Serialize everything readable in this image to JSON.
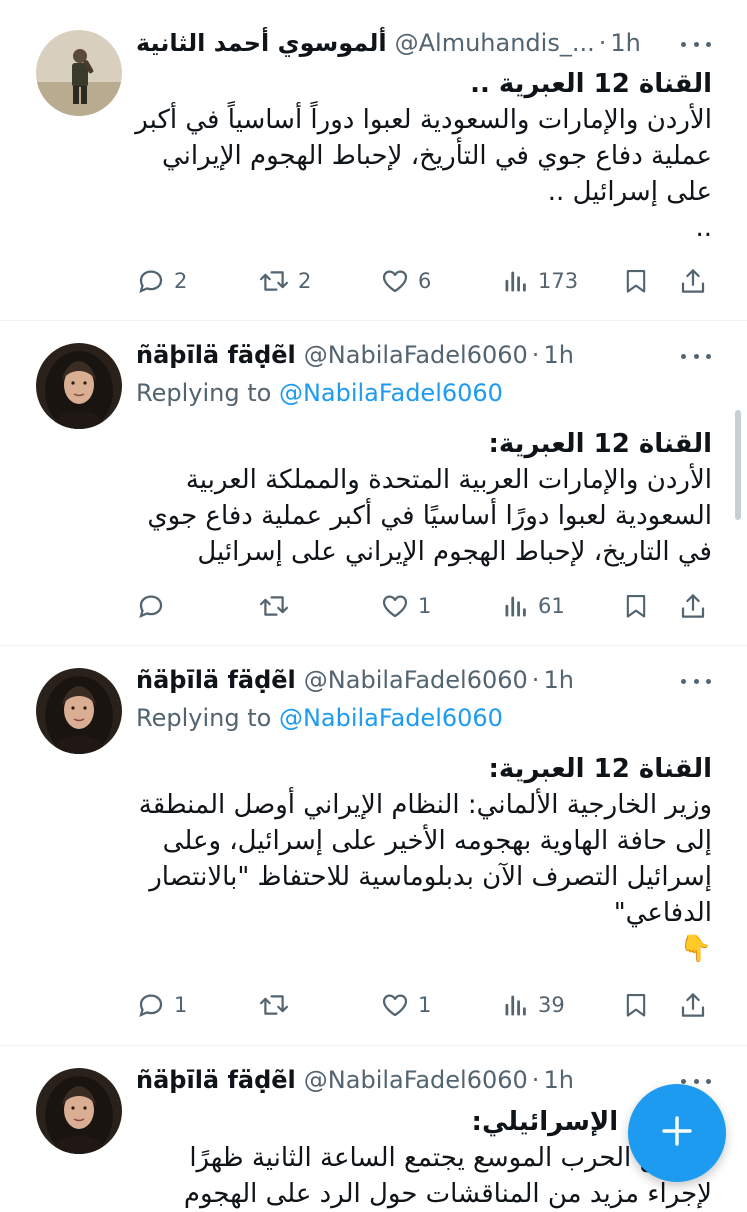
{
  "tweets": [
    {
      "display_name": "ألموسوي أحمد الثانية",
      "handle": "@Almuhandis_...",
      "time": "1h",
      "replying_label": "",
      "replying_to": "",
      "lines": [
        "القناة 12 العبرية ..",
        "الأردن والإمارات والسعودية لعبوا دوراً أساسياً في أكبر",
        "عملية دفاع جوي في التأريخ، لإحباط الهجوم الإيراني",
        "على إسرائيل ..",
        ".."
      ],
      "replies": "2",
      "reposts": "2",
      "likes": "6",
      "views": "173"
    },
    {
      "display_name": "ñäþīlä fäḍẽl",
      "handle": "@NabilaFadel6060",
      "time": "1h",
      "replying_label": "Replying to",
      "replying_to": "@NabilaFadel6060",
      "lines": [
        "القناة 12 العبرية:",
        "الأردن والإمارات العربية المتحدة والمملكة العربية",
        "السعودية لعبوا دورًا أساسيًا في أكبر عملية دفاع جوي",
        "في التاريخ، لإحباط الهجوم الإيراني على إسرائيل"
      ],
      "replies": "",
      "reposts": "",
      "likes": "1",
      "views": "61"
    },
    {
      "display_name": "ñäþīlä fäḍẽl",
      "handle": "@NabilaFadel6060",
      "time": "1h",
      "replying_label": "Replying to",
      "replying_to": "@NabilaFadel6060",
      "lines": [
        "القناة 12 العبرية:",
        "وزير الخارجية الألماني: النظام الإيراني أوصل المنطقة",
        "إلى حافة الهاوية بهجومه الأخير على إسرائيل، وعلى",
        "إسرائيل التصرف الآن بدبلوماسية للاحتفاظ \"بالانتصار",
        "الدفاعي\"",
        "👇"
      ],
      "replies": "1",
      "reposts": "",
      "likes": "1",
      "views": "39"
    },
    {
      "display_name": "ñäþīlä fäḍẽl",
      "handle": "@NabilaFadel6060",
      "time": "1h",
      "replying_label": "",
      "replying_to": "",
      "lines": [
        "الجيش الإسرائيلي:",
        "مجلس الحرب الموسع يجتمع الساعة الثانية ظهرًا",
        "لإجراء مزيد من المناقشات حول الرد على الهجوم"
      ],
      "replies": "",
      "reposts": "",
      "likes": "",
      "views": ""
    }
  ],
  "separator": "·",
  "fab_icon": "plus-icon",
  "colors": {
    "accent": "#1d9bf0",
    "muted": "#536471",
    "text": "#0f1419",
    "divider": "#eff3f4"
  }
}
